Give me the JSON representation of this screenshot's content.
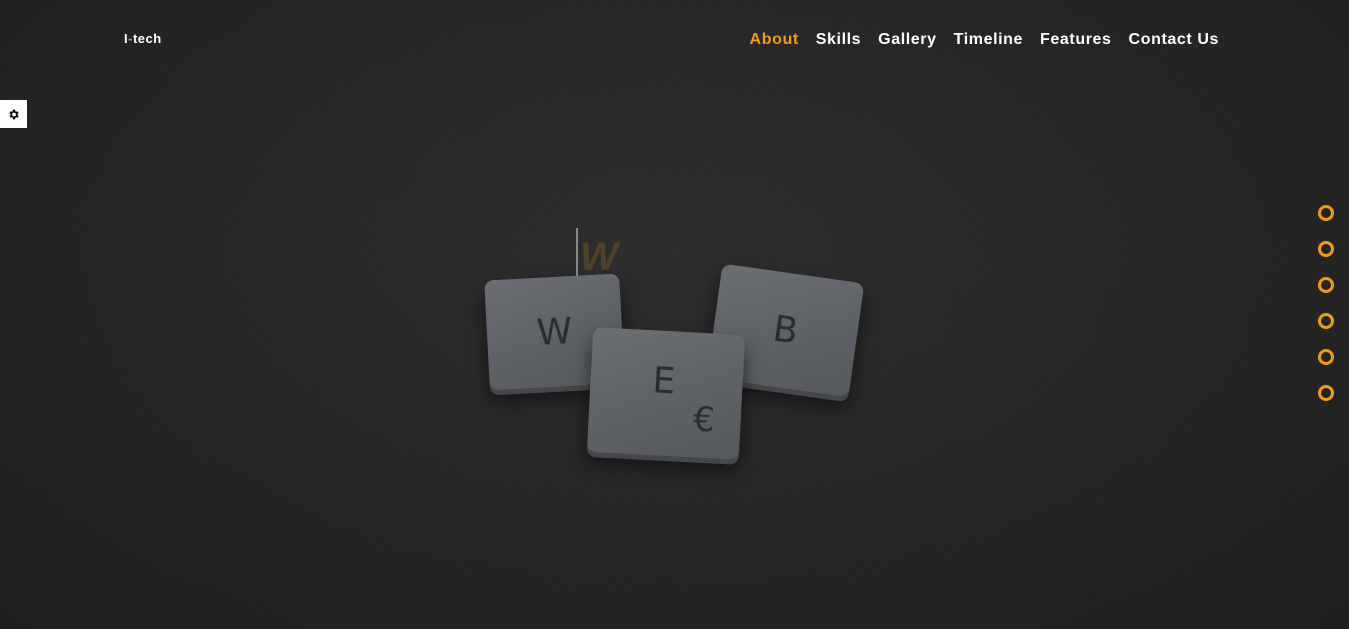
{
  "header": {
    "logo_prefix": "I",
    "logo_dash": "-",
    "logo_suffix": "tech"
  },
  "nav": {
    "items": [
      "About",
      "Skills",
      "Gallery",
      "Timeline",
      "Features",
      "Contact Us"
    ],
    "active": "About"
  },
  "settings": {
    "icon": "gear-icon"
  },
  "hero": {
    "typed_text": "W",
    "tiles": [
      "W",
      "E",
      "B"
    ],
    "tile_extra": "€"
  },
  "bullets": {
    "count": 6
  },
  "colors": {
    "accent": "#f39c12",
    "background": "#262626",
    "nav_text": "#ffffff"
  }
}
